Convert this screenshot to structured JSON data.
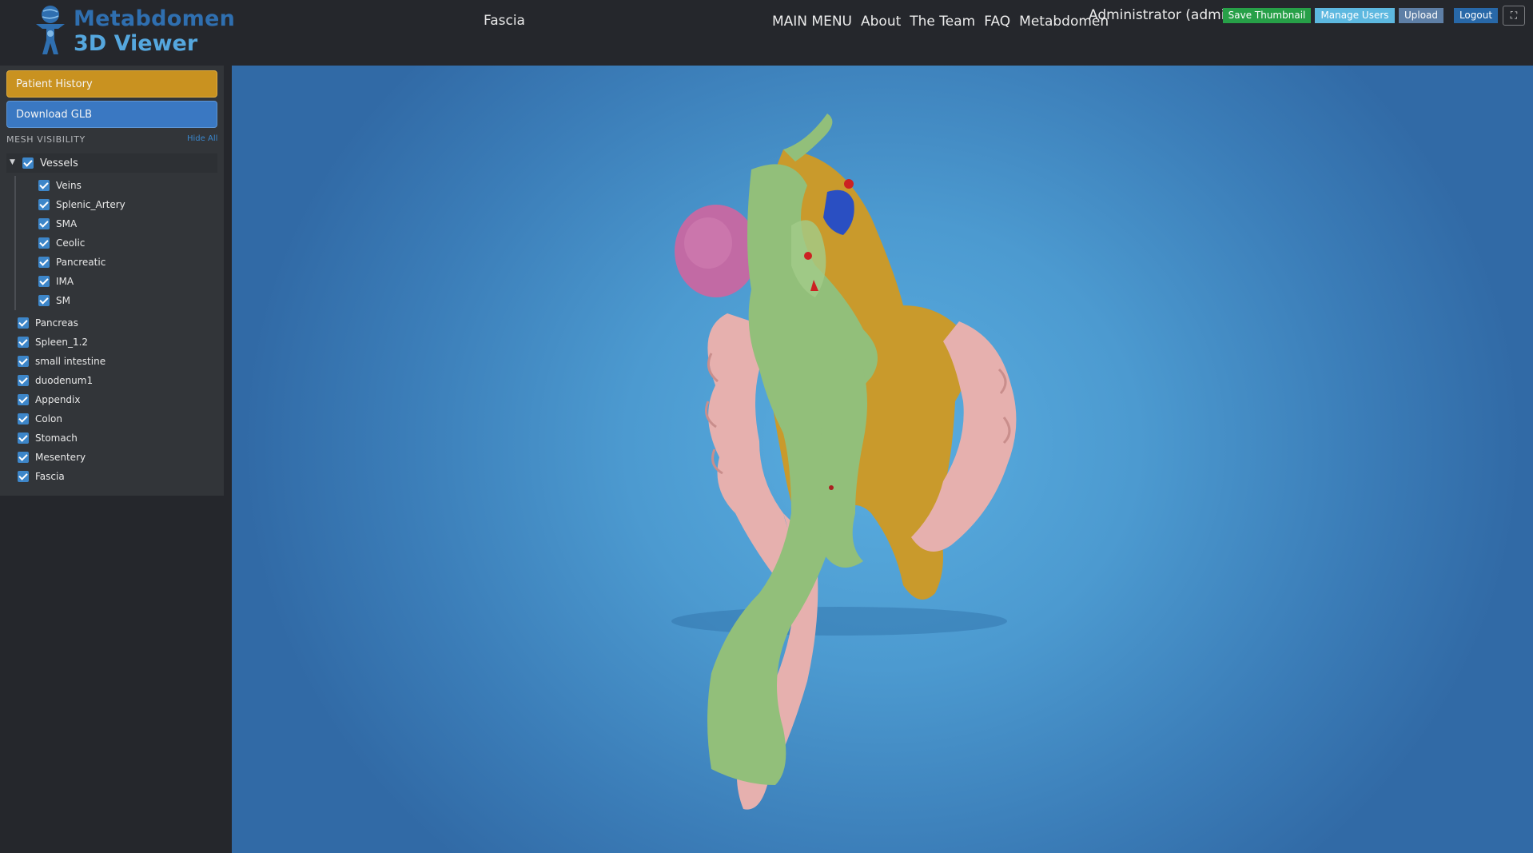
{
  "app": {
    "logo_line1": "Metabdomen",
    "logo_line2": "3D Viewer",
    "current_model": "Fascia"
  },
  "nav": {
    "items": [
      "MAIN MENU",
      "About",
      "The Team",
      "FAQ",
      "Metabdomen"
    ]
  },
  "user": {
    "label": "Administrator (admin)"
  },
  "toolbar": {
    "save_thumbnail": "Save Thumbnail",
    "manage_users": "Manage Users",
    "upload": "Upload",
    "logout": "Logout",
    "fullscreen_icon": "⛶"
  },
  "sidebar": {
    "patient_history": "Patient History",
    "download_glb": "Download GLB",
    "mesh_visibility_title": "MESH VISIBILITY",
    "hide_all": "Hide All",
    "group": {
      "label": "Vessels",
      "checked": true
    },
    "vessels": [
      {
        "label": "Veins",
        "checked": true
      },
      {
        "label": "Splenic_Artery",
        "checked": true
      },
      {
        "label": "SMA",
        "checked": true
      },
      {
        "label": "Ceolic",
        "checked": true
      },
      {
        "label": "Pancreatic",
        "checked": true
      },
      {
        "label": "IMA",
        "checked": true
      },
      {
        "label": "SM",
        "checked": true
      }
    ],
    "meshes": [
      {
        "label": "Pancreas",
        "checked": true
      },
      {
        "label": "Spleen_1.2",
        "checked": true
      },
      {
        "label": "small intestine",
        "checked": true
      },
      {
        "label": "duodenum1",
        "checked": true
      },
      {
        "label": "Appendix",
        "checked": true
      },
      {
        "label": "Colon",
        "checked": true
      },
      {
        "label": "Stomach",
        "checked": true
      },
      {
        "label": "Mesentery",
        "checked": true
      },
      {
        "label": "Fascia",
        "checked": true
      }
    ]
  },
  "colors": {
    "accent": "#3a78c2",
    "history_button": "#c99220",
    "save_button": "#27a048",
    "manage_users_button": "#5db8e0",
    "viewport_blue": "#4c9ad0"
  }
}
